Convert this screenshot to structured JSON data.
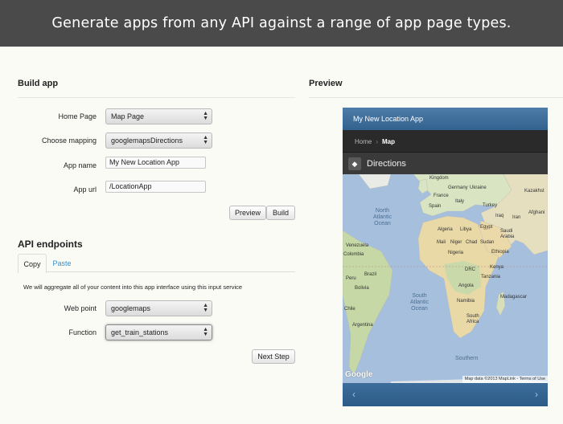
{
  "banner": {
    "text": "Generate apps from any API against a range of app page types."
  },
  "build_app": {
    "heading": "Build app",
    "fields": {
      "home_page": {
        "label": "Home Page",
        "value": "Map Page"
      },
      "mapping": {
        "label": "Choose mapping",
        "value": "googlemapsDirections"
      },
      "app_name": {
        "label": "App name",
        "value": "My New Location App"
      },
      "app_url": {
        "label": "App url",
        "value": "/LocationApp"
      }
    },
    "preview_button": "Preview",
    "build_button": "Build"
  },
  "api": {
    "heading": "API endpoints",
    "tabs": [
      "Copy",
      "Paste"
    ],
    "description": "We will aggregate all of your content into this app interface using this input service",
    "web_point": {
      "label": "Web point",
      "value": "googlemaps"
    },
    "function": {
      "label": "Function",
      "value": "get_train_stations"
    },
    "next_button": "Next Step"
  },
  "preview": {
    "heading": "Preview",
    "app_title": "My New Location App",
    "breadcrumb": {
      "home": "Home",
      "sep": "›",
      "current": "Map"
    },
    "section_title": "Directions",
    "map": {
      "ocean_labels": {
        "north_atlantic": "North\nAtlantic\nOcean",
        "south_atlantic": "South\nAtlantic\nOcean",
        "southern": "Southern"
      },
      "country_labels": {
        "kingdom": "Kingdom",
        "germany": "Germany",
        "ukraine": "Ukraine",
        "kazakhstan": "Kazakhst",
        "france": "France",
        "spain": "Spain",
        "italy": "Italy",
        "turkey": "Turkey",
        "afghanistan": "Afghani",
        "iraq": "Iraq",
        "iran": "Iran",
        "algeria": "Algeria",
        "libya": "Libya",
        "egypt": "Egypt",
        "saudi_arabia": "Saudi\nArabia",
        "mali": "Mali",
        "niger": "Niger",
        "chad": "Chad",
        "sudan": "Sudan",
        "nigeria": "Nigeria",
        "ethiopia": "Ethiopia",
        "venezuela": "Venezuela",
        "colombia": "Colombia",
        "peru": "Peru",
        "brazil": "Brazil",
        "bolivia": "Bolivia",
        "chile": "Chile",
        "argentina": "Argentina",
        "drc": "DRC",
        "kenya": "Kenya",
        "tanzania": "Tanzania",
        "angola": "Angola",
        "namibia": "Namibia",
        "south_africa": "South\nAfrica",
        "madagascar": "Madagascar"
      },
      "google": "Google",
      "attribution": "Map data ©2013 MapLink - Terms of Use"
    },
    "nav_prev": "‹",
    "nav_next": "›"
  },
  "icons": {
    "directions": "directions-icon",
    "select": "select-arrows-icon"
  }
}
